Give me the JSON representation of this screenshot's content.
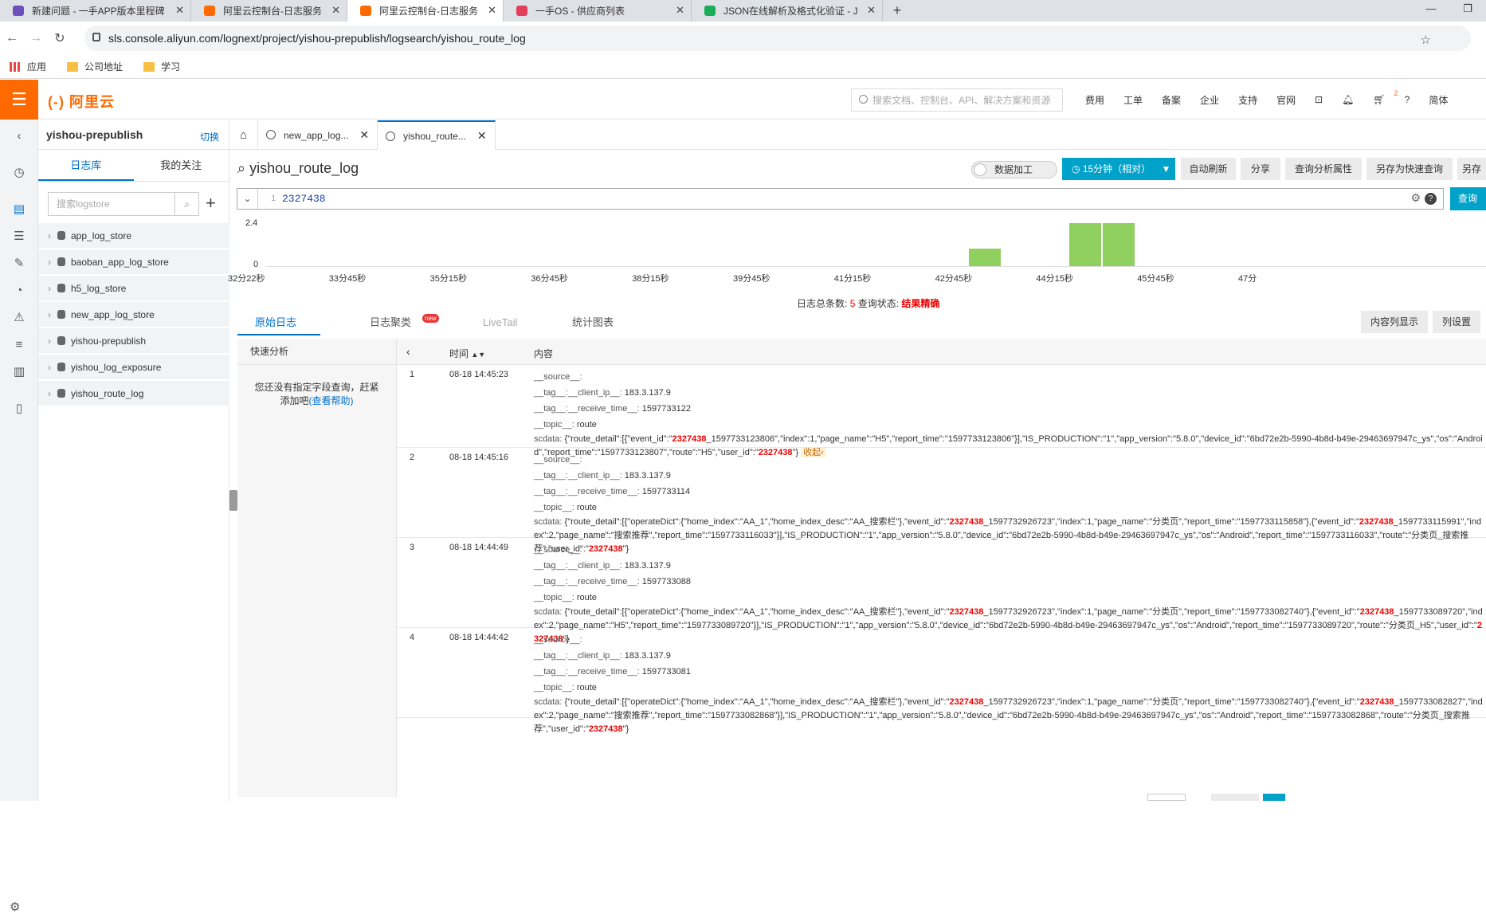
{
  "browser": {
    "tabs": [
      {
        "title": "新建问题 - 一手APP版本里程碑",
        "active": false,
        "icon_color": "#6b4fbb"
      },
      {
        "title": "阿里云控制台-日志服务",
        "active": false,
        "icon_color": "#ff6a00"
      },
      {
        "title": "阿里云控制台-日志服务",
        "active": true,
        "icon_color": "#ff6a00"
      },
      {
        "title": "一手OS - 供应商列表",
        "active": false,
        "icon_color": "#e43f5a"
      },
      {
        "title": "JSON在线解析及格式化验证 - JS",
        "active": false,
        "icon_color": "#1aad5a"
      }
    ],
    "new_tab": "+",
    "url": "sls.console.aliyun.com/lognext/project/yishou-prepublish/logsearch/yishou_route_log",
    "bookmarks": [
      "应用",
      "公司地址",
      "学习"
    ]
  },
  "header": {
    "logo": "阿里云",
    "search_placeholder": "搜索文档、控制台、API、解决方案和资源",
    "nav": [
      "费用",
      "工单",
      "备案",
      "企业",
      "支持",
      "官网"
    ],
    "cart_badge": "2",
    "lang": "简体",
    "accent": "#ff6a00"
  },
  "sidebar": {
    "project": "yishou-prepublish",
    "switch": "切换",
    "tabs": [
      "日志库",
      "我的关注"
    ],
    "search_placeholder": "搜索logstore",
    "stores": [
      "app_log_store",
      "baoban_app_log_store",
      "h5_log_store",
      "new_app_log_store",
      "yishou-prepublish",
      "yishou_log_exposure",
      "yishou_route_log"
    ]
  },
  "logtabs": [
    {
      "label": "new_app_log...",
      "active": false
    },
    {
      "label": "yishou_route...",
      "active": true
    }
  ],
  "toolbar": {
    "title": "yishou_route_log",
    "toggle": "数据加工",
    "time": "15分钟（相对）",
    "buttons": [
      "自动刷新",
      "分享",
      "查询分析属性",
      "另存为快速查询",
      "另存为"
    ]
  },
  "query": {
    "line": "1",
    "text": "2327438",
    "submit": "查询"
  },
  "histogram": {
    "y_ticks": [
      "2.4",
      "0"
    ],
    "x_ticks": [
      "32分22秒",
      "33分45秒",
      "35分15秒",
      "36分45秒",
      "38分15秒",
      "39分45秒",
      "41分15秒",
      "42分45秒",
      "44分15秒",
      "45分45秒",
      "47分"
    ],
    "bars": [
      1,
      2.4,
      2.4
    ]
  },
  "status": {
    "total_label": "日志总条数:",
    "total": "5",
    "state_label": "查询状态:",
    "state": "结果精确"
  },
  "result_tabs": [
    {
      "label": "原始日志",
      "state": "on"
    },
    {
      "label": "日志聚类",
      "state": "normal",
      "badge": "new"
    },
    {
      "label": "LiveTail",
      "state": "disabled"
    },
    {
      "label": "统计图表",
      "state": "normal"
    }
  ],
  "result_buttons": [
    "内容列显示",
    "列设置"
  ],
  "quick": {
    "title": "快速分析",
    "msg": "您还没有指定字段查询，赶紧添加吧",
    "help": "(查看帮助)"
  },
  "table": {
    "col_time": "时间",
    "col_content": "内容"
  },
  "logs": [
    {
      "n": "1",
      "time": "08-18 14:45:23",
      "source": "__source__:",
      "client_ip": "183.3.137.9",
      "receive_time": "1597733122",
      "topic": "route",
      "sc": [
        [
          "{\"route_detail\":[{\"event_id\":\"",
          false
        ],
        [
          "2327438",
          true
        ],
        [
          "_1597733123806\",\"index\":1,\"page_name\":\"H5\",\"report_time\":\"1597733123806\"}],\"IS_PRODUCTION\":\"1\",\"app_version\":\"5.8.0\",\"device_id\":\"6bd72e2b-5990-4b8d-b49e-29463697947c_ys\",\"os\":\"Android\",\"report_time\":\"1597733123807\",\"route\":\"H5\",\"user_id\":\"",
          false
        ],
        [
          "2327438",
          true
        ],
        [
          "\"}",
          false
        ]
      ],
      "collapse": "收起‹"
    },
    {
      "n": "2",
      "time": "08-18 14:45:16",
      "source": "__source__:",
      "client_ip": "183.3.137.9",
      "receive_time": "1597733114",
      "topic": "route",
      "sc": [
        [
          "{\"route_detail\":[{\"operateDict\":{\"home_index\":\"AA_1\",\"home_index_desc\":\"AA_搜索栏\"},\"event_id\":\"",
          false
        ],
        [
          "2327438",
          true
        ],
        [
          "_1597732926723\",\"index\":1,\"page_name\":\"分类页\",\"report_time\":\"1597733115858\"},{\"event_id\":\"",
          false
        ],
        [
          "2327438",
          true
        ],
        [
          "_1597733115991\",\"index\":2,\"page_name\":\"搜索推荐\",\"report_time\":\"1597733116033\"}],\"IS_PRODUCTION\":\"1\",\"app_version\":\"5.8.0\",\"device_id\":\"6bd72e2b-5990-4b8d-b49e-29463697947c_ys\",\"os\":\"Android\",\"report_time\":\"1597733116033\",\"route\":\"分类页_搜索推荐\",\"user_id\":\"",
          false
        ],
        [
          "2327438",
          true
        ],
        [
          "\"}",
          false
        ]
      ],
      "collapse": ""
    },
    {
      "n": "3",
      "time": "08-18 14:44:49",
      "source": "__source__:",
      "client_ip": "183.3.137.9",
      "receive_time": "1597733088",
      "topic": "route",
      "sc": [
        [
          "{\"route_detail\":[{\"operateDict\":{\"home_index\":\"AA_1\",\"home_index_desc\":\"AA_搜索栏\"},\"event_id\":\"",
          false
        ],
        [
          "2327438",
          true
        ],
        [
          "_1597732926723\",\"index\":1,\"page_name\":\"分类页\",\"report_time\":\"1597733082740\"},{\"event_id\":\"",
          false
        ],
        [
          "2327438",
          true
        ],
        [
          "_1597733089720\",\"index\":2,\"page_name\":\"H5\",\"report_time\":\"1597733089720\"}],\"IS_PRODUCTION\":\"1\",\"app_version\":\"5.8.0\",\"device_id\":\"6bd72e2b-5990-4b8d-b49e-29463697947c_ys\",\"os\":\"Android\",\"report_time\":\"1597733089720\",\"route\":\"分类页_H5\",\"user_id\":\"",
          false
        ],
        [
          "2327438",
          true
        ],
        [
          "\"}",
          false
        ]
      ],
      "collapse": ""
    },
    {
      "n": "4",
      "time": "08-18 14:44:42",
      "source": "__source__:",
      "client_ip": "183.3.137.9",
      "receive_time": "1597733081",
      "topic": "route",
      "sc": [
        [
          "{\"route_detail\":[{\"operateDict\":{\"home_index\":\"AA_1\",\"home_index_desc\":\"AA_搜索栏\"},\"event_id\":\"",
          false
        ],
        [
          "2327438",
          true
        ],
        [
          "_1597732926723\",\"index\":1,\"page_name\":\"分类页\",\"report_time\":\"1597733082740\"},{\"event_id\":\"",
          false
        ],
        [
          "2327438",
          true
        ],
        [
          "_1597733082827\",\"index\":2,\"page_name\":\"搜索推荐\",\"report_time\":\"1597733082868\"}],\"IS_PRODUCTION\":\"1\",\"app_version\":\"5.8.0\",\"device_id\":\"6bd72e2b-5990-4b8d-b49e-29463697947c_ys\",\"os\":\"Android\",\"report_time\":\"1597733082868\",\"route\":\"分类页_搜索推荐\",\"user_id\":\"",
          false
        ],
        [
          "2327438",
          true
        ],
        [
          "\"}",
          false
        ]
      ],
      "collapse": ""
    }
  ],
  "field_labels": {
    "tag_ip": "__tag__:__client_ip__:",
    "tag_rt": "__tag__:__receive_time__:",
    "topic": "__topic__:",
    "scdata": "scdata:"
  }
}
